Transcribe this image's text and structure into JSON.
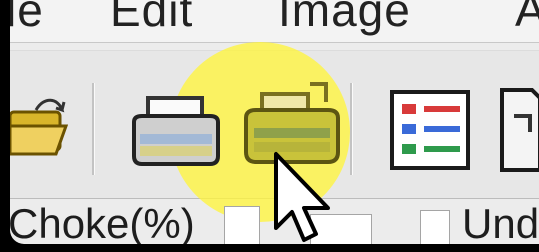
{
  "menu": [
    "le",
    "Edit",
    "Image",
    "A"
  ],
  "toolbar": {
    "tools": [
      {
        "icon": "open-folder-icon",
        "state": "normal"
      },
      {
        "icon": "printer-icon",
        "state": "normal"
      },
      {
        "icon": "print-preview-icon",
        "state": "hovered"
      },
      {
        "icon": "list-view-icon",
        "state": "normal"
      },
      {
        "icon": "document-icon",
        "state": "normal"
      }
    ]
  },
  "fields": {
    "choke_label": "Choke(%)",
    "und_label": "Und"
  },
  "colors": {
    "highlight": "#fff53c",
    "window_bg": "#ececec",
    "toolbar_bg": "#e7e7e7"
  }
}
